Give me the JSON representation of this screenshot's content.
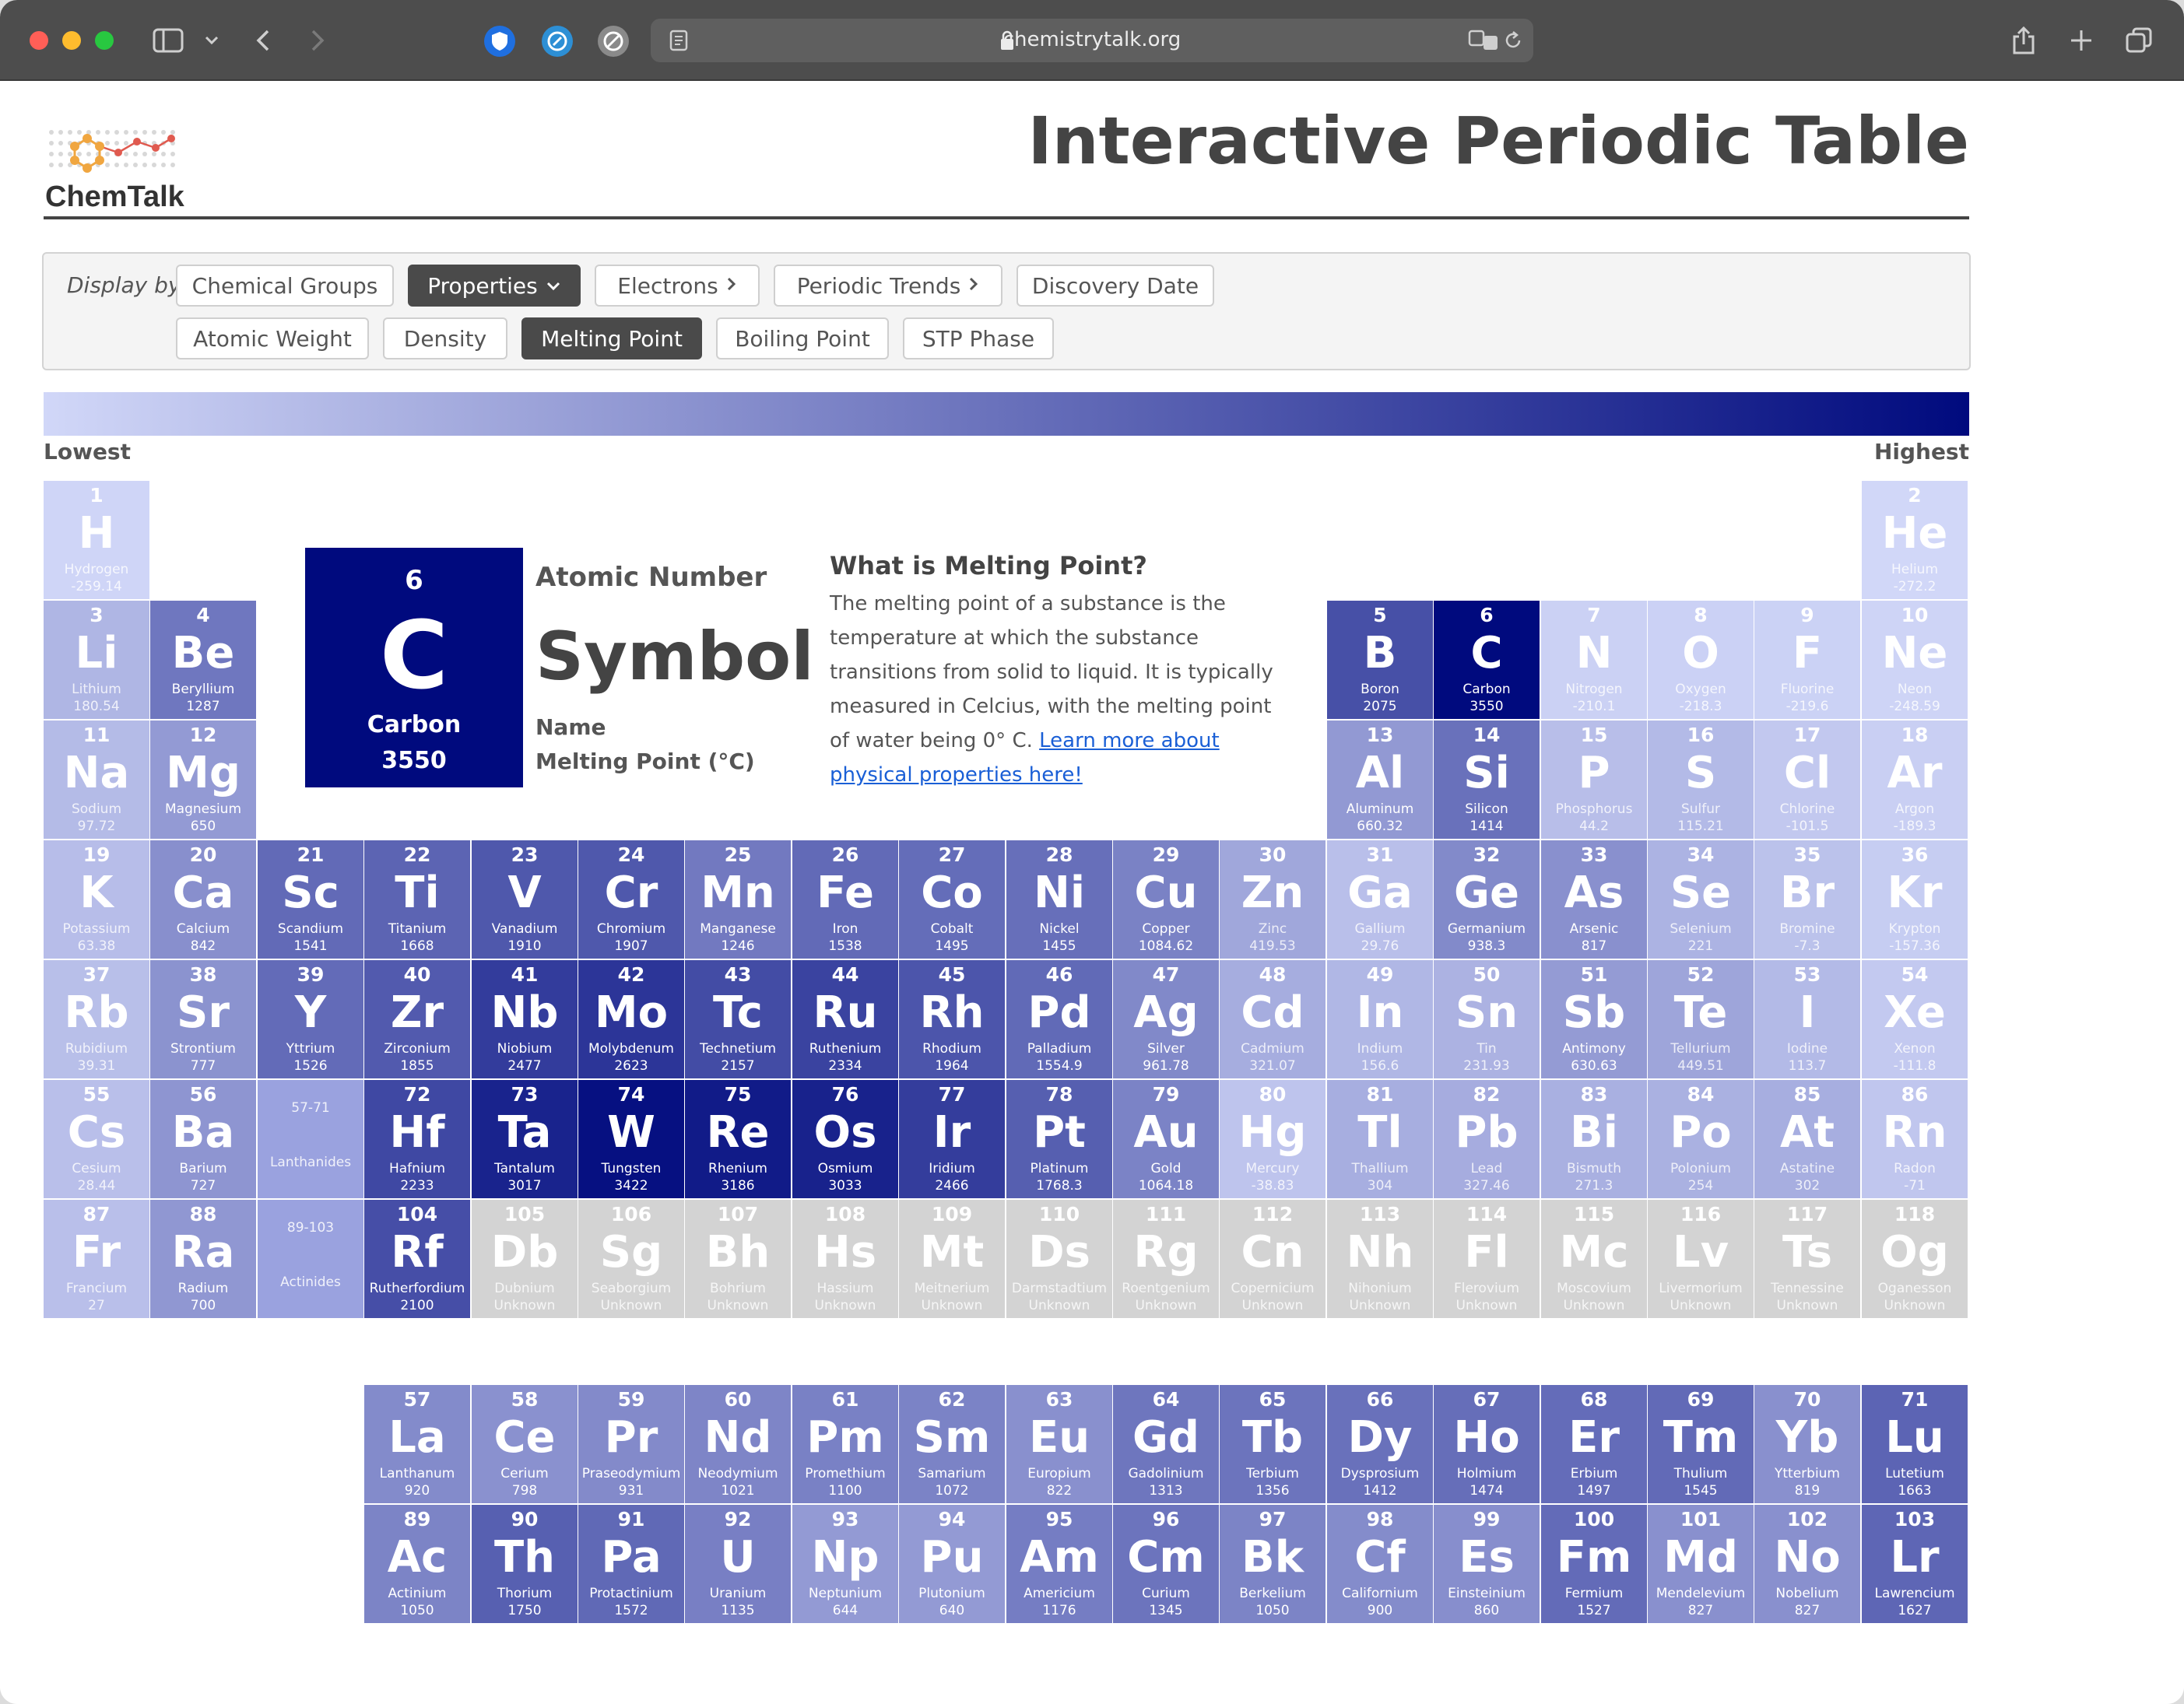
{
  "browser": {
    "url": "chemistrytalk.org",
    "extension_icons": [
      "privacy-shield-icon",
      "compass-icon",
      "ad-block-icon"
    ]
  },
  "header": {
    "logo_text": "ChemTalk",
    "title": "Interactive Periodic Table"
  },
  "controls": {
    "display_by_label": "Display by",
    "row1": [
      "Chemical Groups",
      "Properties",
      "Electrons",
      "Periodic Trends",
      "Discovery Date"
    ],
    "row2": [
      "Atomic Weight",
      "Density",
      "Melting Point",
      "Boiling Point",
      "STP Phase"
    ],
    "active_top": "Properties",
    "active_sub": "Melting Point"
  },
  "legend": {
    "low": "Lowest",
    "high": "Highest",
    "gradient_start": "#d1d7f8",
    "gradient_end": "#000a7e"
  },
  "key": {
    "number": "6",
    "symbol": "C",
    "name": "Carbon",
    "value": "3550",
    "label_number": "Atomic Number",
    "label_symbol": "Symbol",
    "label_name": "Name",
    "label_value": "Melting Point (°C)"
  },
  "info": {
    "heading": "What is Melting Point?",
    "text": "The melting point of a substance is the temperature at which the substance transitions from solid to liquid. It is typically measured in Celcius, with the melting point of water being 0° C. ",
    "link": "Learn more about physical properties here!"
  },
  "placeholders": [
    {
      "range": "57-71",
      "label": "Lanthanides"
    },
    {
      "range": "89-103",
      "label": "Actinides"
    }
  ],
  "elements": [
    [
      "1",
      "H",
      "Hydrogen",
      "-259.14"
    ],
    [
      "2",
      "He",
      "Helium",
      "-272.2"
    ],
    [
      "3",
      "Li",
      "Lithium",
      "180.54"
    ],
    [
      "4",
      "Be",
      "Beryllium",
      "1287"
    ],
    [
      "5",
      "B",
      "Boron",
      "2075"
    ],
    [
      "6",
      "C",
      "Carbon",
      "3550"
    ],
    [
      "7",
      "N",
      "Nitrogen",
      "-210.1"
    ],
    [
      "8",
      "O",
      "Oxygen",
      "-218.3"
    ],
    [
      "9",
      "F",
      "Fluorine",
      "-219.6"
    ],
    [
      "10",
      "Ne",
      "Neon",
      "-248.59"
    ],
    [
      "11",
      "Na",
      "Sodium",
      "97.72"
    ],
    [
      "12",
      "Mg",
      "Magnesium",
      "650"
    ],
    [
      "13",
      "Al",
      "Aluminum",
      "660.32"
    ],
    [
      "14",
      "Si",
      "Silicon",
      "1414"
    ],
    [
      "15",
      "P",
      "Phosphorus",
      "44.2"
    ],
    [
      "16",
      "S",
      "Sulfur",
      "115.21"
    ],
    [
      "17",
      "Cl",
      "Chlorine",
      "-101.5"
    ],
    [
      "18",
      "Ar",
      "Argon",
      "-189.3"
    ],
    [
      "19",
      "K",
      "Potassium",
      "63.38"
    ],
    [
      "20",
      "Ca",
      "Calcium",
      "842"
    ],
    [
      "21",
      "Sc",
      "Scandium",
      "1541"
    ],
    [
      "22",
      "Ti",
      "Titanium",
      "1668"
    ],
    [
      "23",
      "V",
      "Vanadium",
      "1910"
    ],
    [
      "24",
      "Cr",
      "Chromium",
      "1907"
    ],
    [
      "25",
      "Mn",
      "Manganese",
      "1246"
    ],
    [
      "26",
      "Fe",
      "Iron",
      "1538"
    ],
    [
      "27",
      "Co",
      "Cobalt",
      "1495"
    ],
    [
      "28",
      "Ni",
      "Nickel",
      "1455"
    ],
    [
      "29",
      "Cu",
      "Copper",
      "1084.62"
    ],
    [
      "30",
      "Zn",
      "Zinc",
      "419.53"
    ],
    [
      "31",
      "Ga",
      "Gallium",
      "29.76"
    ],
    [
      "32",
      "Ge",
      "Germanium",
      "938.3"
    ],
    [
      "33",
      "As",
      "Arsenic",
      "817"
    ],
    [
      "34",
      "Se",
      "Selenium",
      "221"
    ],
    [
      "35",
      "Br",
      "Bromine",
      "-7.3"
    ],
    [
      "36",
      "Kr",
      "Krypton",
      "-157.36"
    ],
    [
      "37",
      "Rb",
      "Rubidium",
      "39.31"
    ],
    [
      "38",
      "Sr",
      "Strontium",
      "777"
    ],
    [
      "39",
      "Y",
      "Yttrium",
      "1526"
    ],
    [
      "40",
      "Zr",
      "Zirconium",
      "1855"
    ],
    [
      "41",
      "Nb",
      "Niobium",
      "2477"
    ],
    [
      "42",
      "Mo",
      "Molybdenum",
      "2623"
    ],
    [
      "43",
      "Tc",
      "Technetium",
      "2157"
    ],
    [
      "44",
      "Ru",
      "Ruthenium",
      "2334"
    ],
    [
      "45",
      "Rh",
      "Rhodium",
      "1964"
    ],
    [
      "46",
      "Pd",
      "Palladium",
      "1554.9"
    ],
    [
      "47",
      "Ag",
      "Silver",
      "961.78"
    ],
    [
      "48",
      "Cd",
      "Cadmium",
      "321.07"
    ],
    [
      "49",
      "In",
      "Indium",
      "156.6"
    ],
    [
      "50",
      "Sn",
      "Tin",
      "231.93"
    ],
    [
      "51",
      "Sb",
      "Antimony",
      "630.63"
    ],
    [
      "52",
      "Te",
      "Tellurium",
      "449.51"
    ],
    [
      "53",
      "I",
      "Iodine",
      "113.7"
    ],
    [
      "54",
      "Xe",
      "Xenon",
      "-111.8"
    ],
    [
      "55",
      "Cs",
      "Cesium",
      "28.44"
    ],
    [
      "56",
      "Ba",
      "Barium",
      "727"
    ],
    [
      "72",
      "Hf",
      "Hafnium",
      "2233"
    ],
    [
      "73",
      "Ta",
      "Tantalum",
      "3017"
    ],
    [
      "74",
      "W",
      "Tungsten",
      "3422"
    ],
    [
      "75",
      "Re",
      "Rhenium",
      "3186"
    ],
    [
      "76",
      "Os",
      "Osmium",
      "3033"
    ],
    [
      "77",
      "Ir",
      "Iridium",
      "2466"
    ],
    [
      "78",
      "Pt",
      "Platinum",
      "1768.3"
    ],
    [
      "79",
      "Au",
      "Gold",
      "1064.18"
    ],
    [
      "80",
      "Hg",
      "Mercury",
      "-38.83"
    ],
    [
      "81",
      "Tl",
      "Thallium",
      "304"
    ],
    [
      "82",
      "Pb",
      "Lead",
      "327.46"
    ],
    [
      "83",
      "Bi",
      "Bismuth",
      "271.3"
    ],
    [
      "84",
      "Po",
      "Polonium",
      "254"
    ],
    [
      "85",
      "At",
      "Astatine",
      "302"
    ],
    [
      "86",
      "Rn",
      "Radon",
      "-71"
    ],
    [
      "87",
      "Fr",
      "Francium",
      "27"
    ],
    [
      "88",
      "Ra",
      "Radium",
      "700"
    ],
    [
      "104",
      "Rf",
      "Rutherfordium",
      "2100"
    ],
    [
      "105",
      "Db",
      "Dubnium",
      "Unknown"
    ],
    [
      "106",
      "Sg",
      "Seaborgium",
      "Unknown"
    ],
    [
      "107",
      "Bh",
      "Bohrium",
      "Unknown"
    ],
    [
      "108",
      "Hs",
      "Hassium",
      "Unknown"
    ],
    [
      "109",
      "Mt",
      "Meitnerium",
      "Unknown"
    ],
    [
      "110",
      "Ds",
      "Darmstadtium",
      "Unknown"
    ],
    [
      "111",
      "Rg",
      "Roentgenium",
      "Unknown"
    ],
    [
      "112",
      "Cn",
      "Copernicium",
      "Unknown"
    ],
    [
      "113",
      "Nh",
      "Nihonium",
      "Unknown"
    ],
    [
      "114",
      "Fl",
      "Flerovium",
      "Unknown"
    ],
    [
      "115",
      "Mc",
      "Moscovium",
      "Unknown"
    ],
    [
      "116",
      "Lv",
      "Livermorium",
      "Unknown"
    ],
    [
      "117",
      "Ts",
      "Tennessine",
      "Unknown"
    ],
    [
      "118",
      "Og",
      "Oganesson",
      "Unknown"
    ],
    [
      "57",
      "La",
      "Lanthanum",
      "920"
    ],
    [
      "58",
      "Ce",
      "Cerium",
      "798"
    ],
    [
      "59",
      "Pr",
      "Praseodymium",
      "931"
    ],
    [
      "60",
      "Nd",
      "Neodymium",
      "1021"
    ],
    [
      "61",
      "Pm",
      "Promethium",
      "1100"
    ],
    [
      "62",
      "Sm",
      "Samarium",
      "1072"
    ],
    [
      "63",
      "Eu",
      "Europium",
      "822"
    ],
    [
      "64",
      "Gd",
      "Gadolinium",
      "1313"
    ],
    [
      "65",
      "Tb",
      "Terbium",
      "1356"
    ],
    [
      "66",
      "Dy",
      "Dysprosium",
      "1412"
    ],
    [
      "67",
      "Ho",
      "Holmium",
      "1474"
    ],
    [
      "68",
      "Er",
      "Erbium",
      "1497"
    ],
    [
      "69",
      "Tm",
      "Thulium",
      "1545"
    ],
    [
      "70",
      "Yb",
      "Ytterbium",
      "819"
    ],
    [
      "71",
      "Lu",
      "Lutetium",
      "1663"
    ],
    [
      "89",
      "Ac",
      "Actinium",
      "1050"
    ],
    [
      "90",
      "Th",
      "Thorium",
      "1750"
    ],
    [
      "91",
      "Pa",
      "Protactinium",
      "1572"
    ],
    [
      "92",
      "U",
      "Uranium",
      "1135"
    ],
    [
      "93",
      "Np",
      "Neptunium",
      "644"
    ],
    [
      "94",
      "Pu",
      "Plutonium",
      "640"
    ],
    [
      "95",
      "Am",
      "Americium",
      "1176"
    ],
    [
      "96",
      "Cm",
      "Curium",
      "1345"
    ],
    [
      "97",
      "Bk",
      "Berkelium",
      "1050"
    ],
    [
      "98",
      "Cf",
      "Californium",
      "900"
    ],
    [
      "99",
      "Es",
      "Einsteinium",
      "860"
    ],
    [
      "100",
      "Fm",
      "Fermium",
      "1527"
    ],
    [
      "101",
      "Md",
      "Mendelevium",
      "827"
    ],
    [
      "102",
      "No",
      "Nobelium",
      "827"
    ],
    [
      "103",
      "Lr",
      "Lawrencium",
      "1627"
    ]
  ]
}
